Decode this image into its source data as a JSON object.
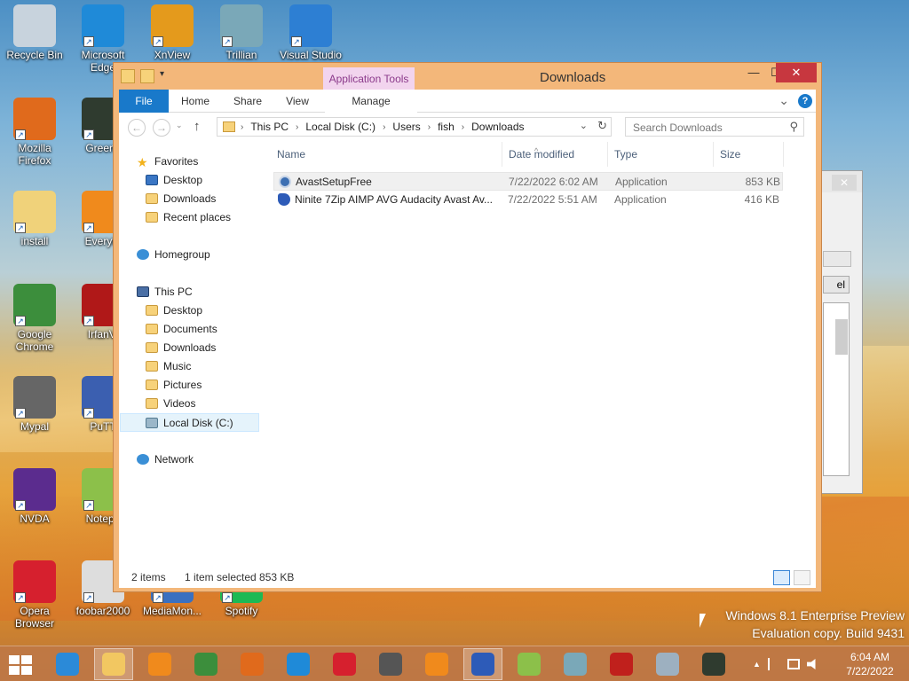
{
  "desktop": {
    "icons": [
      {
        "label": "Recycle Bin",
        "color": "#c8d3dd"
      },
      {
        "label": "Microsoft Edge",
        "color": "#1f8ad8"
      },
      {
        "label": "XnView",
        "color": "#e49a1c"
      },
      {
        "label": "Trillian",
        "color": "#7aa8b8"
      },
      {
        "label": "Visual Studio",
        "color": "#2d7fd3"
      },
      {
        "label": "Mozilla Firefox",
        "color": "#e06a1c"
      },
      {
        "label": "Greens",
        "color": "#2f3b2f"
      },
      {
        "label": "install",
        "color": "#f0d27a"
      },
      {
        "label": "Everyth",
        "color": "#f08a1c"
      },
      {
        "label": "Google Chrome",
        "color": "#3c8e3c"
      },
      {
        "label": "IrfanVi",
        "color": "#b01818"
      },
      {
        "label": "Mypal",
        "color": "#666666"
      },
      {
        "label": "PuTT",
        "color": "#3b5fb0"
      },
      {
        "label": "NVDA",
        "color": "#5b2c8e"
      },
      {
        "label": "Notepa",
        "color": "#8cc04a"
      },
      {
        "label": "Opera Browser",
        "color": "#d6202e"
      },
      {
        "label": "foobar2000",
        "color": "#dddddd"
      },
      {
        "label": "MediaMon...",
        "color": "#3a70c0"
      },
      {
        "label": "Spotify",
        "color": "#1db954"
      }
    ]
  },
  "window": {
    "title": "Downloads",
    "app_tools": "Application Tools",
    "min_glyph": "—",
    "max_glyph": "☐",
    "close_glyph": "✕"
  },
  "ribbon": {
    "tabs": {
      "file": "File",
      "home": "Home",
      "share": "Share",
      "view": "View",
      "manage": "Manage"
    },
    "expand_glyph": "⌄",
    "help_glyph": "?"
  },
  "nav": {
    "back_glyph": "←",
    "forward_glyph": "→",
    "up_glyph": "↑",
    "path": [
      "This PC",
      "Local Disk (C:)",
      "Users",
      "fish",
      "Downloads"
    ],
    "sep_glyph": "›",
    "dropdown_glyph": "⌄",
    "refresh_glyph": "↻",
    "search_placeholder": "Search Downloads",
    "search_glyph": "⚲"
  },
  "navpane": {
    "favorites": "Favorites",
    "fav_items": [
      "Desktop",
      "Downloads",
      "Recent places"
    ],
    "homegroup": "Homegroup",
    "thispc": "This PC",
    "pc_items": [
      "Desktop",
      "Documents",
      "Downloads",
      "Music",
      "Pictures",
      "Videos",
      "Local Disk (C:)"
    ],
    "network": "Network"
  },
  "columns": {
    "name": "Name",
    "date": "Date modified",
    "type": "Type",
    "size": "Size",
    "sort_glyph": "^"
  },
  "files": [
    {
      "name": "AvastSetupFree",
      "date": "7/22/2022 6:02 AM",
      "type": "Application",
      "size": "853 KB"
    },
    {
      "name": "Ninite 7Zip AIMP AVG Audacity Avast Av...",
      "date": "7/22/2022 5:51 AM",
      "type": "Application",
      "size": "416 KB"
    }
  ],
  "status": {
    "items": "2 items",
    "selected": "1 item selected  853 KB"
  },
  "back_dialog": {
    "close_glyph": "✕",
    "btn_fragment": "el"
  },
  "watermark": {
    "line1": "Windows 8.1 Enterprise Preview",
    "line2": "Evaluation copy. Build 9431"
  },
  "taskbar": {
    "apps": [
      {
        "name": "internet-explorer",
        "color": "#2b8ad8"
      },
      {
        "name": "file-explorer",
        "color": "#f2c761"
      },
      {
        "name": "media",
        "color": "#f08a1c"
      },
      {
        "name": "chrome",
        "color": "#3c8e3c"
      },
      {
        "name": "firefox",
        "color": "#e06a1c"
      },
      {
        "name": "edge",
        "color": "#1f8ad8"
      },
      {
        "name": "opera",
        "color": "#d6202e"
      },
      {
        "name": "mypal",
        "color": "#555555"
      },
      {
        "name": "everything",
        "color": "#f08a1c"
      },
      {
        "name": "ninite",
        "color": "#2d5bb8"
      },
      {
        "name": "notepad",
        "color": "#8cc04a"
      },
      {
        "name": "trillian",
        "color": "#7aa8b8"
      },
      {
        "name": "filezilla",
        "color": "#c0201c"
      },
      {
        "name": "monitor",
        "color": "#9db0c0"
      },
      {
        "name": "greenshot",
        "color": "#2f3b2f"
      }
    ],
    "tray_up": "▲",
    "time": "6:04 AM",
    "date": "7/22/2022"
  }
}
